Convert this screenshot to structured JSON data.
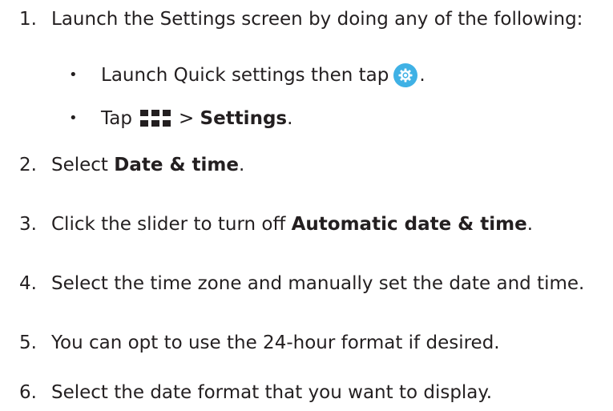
{
  "steps": [
    {
      "num": "1.",
      "text": "Launch the Settings screen by doing any of the following:"
    },
    {
      "num": "2.",
      "text_before": "Select ",
      "bold": "Date & time",
      "text_after": "."
    },
    {
      "num": "3.",
      "text_before": "Click the slider to turn off ",
      "bold": "Automatic date & time",
      "text_after": "."
    },
    {
      "num": "4.",
      "text": "Select the time zone and manually set the date and time."
    },
    {
      "num": "5.",
      "text": "You can opt to use the 24-hour format if desired."
    },
    {
      "num": "6.",
      "text": "Select the date format that you want to display."
    }
  ],
  "substeps": [
    {
      "bullet": "•",
      "text_before": "Launch Quick settings then tap",
      "icon": "settings-gear-icon",
      "text_after": "."
    },
    {
      "bullet": "•",
      "text_before": "Tap",
      "icon": "apps-grid-icon",
      "text_mid": "> ",
      "bold": "Settings",
      "text_after": "."
    }
  ],
  "colors": {
    "text": "#231f20",
    "gear_icon_bg": "#3fb1e5"
  }
}
